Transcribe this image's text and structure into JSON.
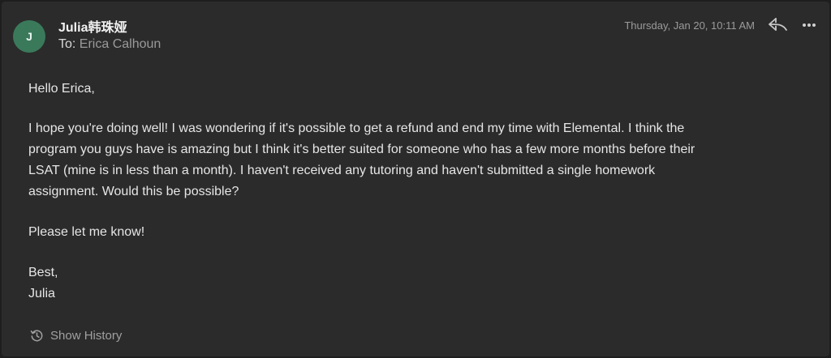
{
  "header": {
    "avatar_initial": "J",
    "avatar_color": "#3a7a5b",
    "sender_name": "Julia韩珠娅",
    "to_label": "To:",
    "to_value": "Erica Calhoun",
    "date": "Thursday, Jan 20, 10:11 AM",
    "icons": [
      "reply-icon",
      "more-icon"
    ]
  },
  "message": {
    "greeting": "Hello Erica,",
    "paragraph_lines": [
      "I hope you're doing well! I was wondering if it's possible to get a refund and end my time with Elemental. I think the",
      "program you guys have is amazing but I think it's better suited for someone who has a few more months before their",
      "LSAT (mine is in less than a month). I haven't received any tutoring and haven't submitted a single homework",
      "assignment. Would this be possible?"
    ],
    "request": "Please let me know!",
    "closing": "Best,",
    "signature": "Julia"
  },
  "footer": {
    "show_history_label": "Show History",
    "icon": "history-icon"
  }
}
